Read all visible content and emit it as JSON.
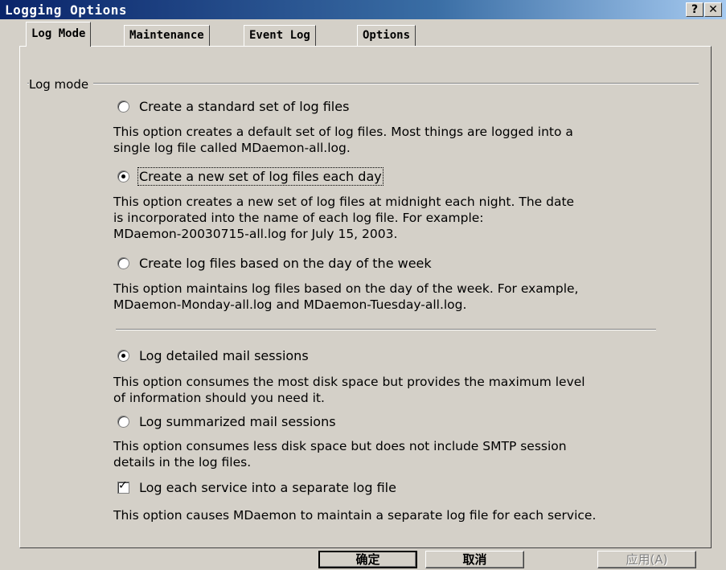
{
  "window": {
    "title": "Logging Options",
    "help_label": "?",
    "close_label": "✕"
  },
  "tabs": [
    "Log Mode",
    "Maintenance",
    "Event Log",
    "Options"
  ],
  "group": {
    "label": "Log mode"
  },
  "log_mode_options": [
    {
      "label": "Create a standard set of log files",
      "selected": false,
      "description": "This option creates a default set of log files.  Most things are logged into a\nsingle log file called MDaemon-all.log."
    },
    {
      "label": "Create a new set of log files each day",
      "selected": true,
      "description": "This option creates a new set of log files at midnight each night.  The date\nis incorporated into the name of each log file.  For example:\nMDaemon-20030715-all.log for July 15, 2003."
    },
    {
      "label": "Create log files based on the day of the week",
      "selected": false,
      "description": "This option maintains log files based on the day of the week.  For example,\nMDaemon-Monday-all.log and MDaemon-Tuesday-all.log."
    }
  ],
  "detail_options": [
    {
      "label": "Log detailed mail sessions",
      "selected": true,
      "description": "This option consumes the most disk space but provides the maximum level\nof information should you need it."
    },
    {
      "label": "Log summarized mail sessions",
      "selected": false,
      "description": "This option consumes less disk space but does not include SMTP session\ndetails in the log files."
    }
  ],
  "separate_log": {
    "label": "Log each service into a separate log file",
    "checked": true,
    "description": "This option causes MDaemon to maintain a separate log file for each service."
  },
  "buttons": {
    "ok": "确定",
    "cancel": "取消",
    "apply": "应用(A)"
  }
}
